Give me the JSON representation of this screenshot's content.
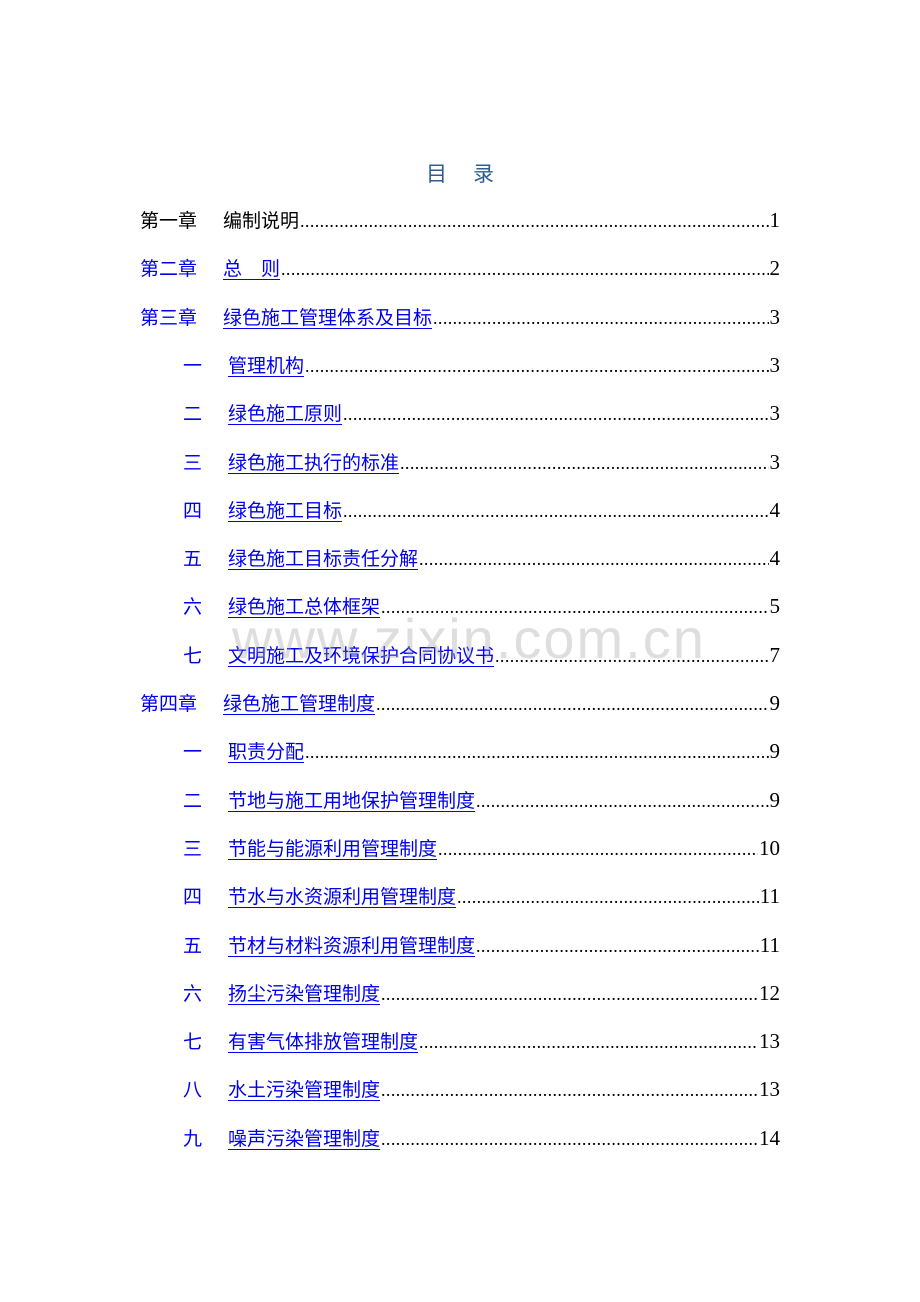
{
  "document": {
    "title_chars": [
      "目",
      "录"
    ],
    "watermark": "www.zixin.com.cn",
    "entries": [
      {
        "level": 1,
        "num": "第一章",
        "title": "编制说明",
        "page": "1",
        "linked": false
      },
      {
        "level": 1,
        "num": "第二章",
        "title": "总　则",
        "page": "2",
        "linked": true
      },
      {
        "level": 1,
        "num": "第三章",
        "title": "绿色施工管理体系及目标",
        "page": "3",
        "linked": true
      },
      {
        "level": 2,
        "num": "一",
        "title": "管理机构",
        "page": "3",
        "linked": true
      },
      {
        "level": 2,
        "num": "二",
        "title": "绿色施工原则",
        "page": "3",
        "linked": true
      },
      {
        "level": 2,
        "num": "三",
        "title": "绿色施工执行的标准",
        "page": "3",
        "linked": true
      },
      {
        "level": 2,
        "num": "四",
        "title": "绿色施工目标",
        "page": "4",
        "linked": true
      },
      {
        "level": 2,
        "num": "五",
        "title": "绿色施工目标责任分解",
        "page": "4",
        "linked": true
      },
      {
        "level": 2,
        "num": "六",
        "title": "绿色施工总体框架",
        "page": "5",
        "linked": true
      },
      {
        "level": 2,
        "num": "七",
        "title": "文明施工及环境保护合同协议书",
        "page": "7",
        "linked": true
      },
      {
        "level": 1,
        "num": "第四章",
        "title": "绿色施工管理制度",
        "page": "9",
        "linked": true
      },
      {
        "level": 2,
        "num": "一",
        "title": "职责分配",
        "page": "9",
        "linked": true
      },
      {
        "level": 2,
        "num": "二",
        "title": "节地与施工用地保护管理制度",
        "page": "9",
        "linked": true
      },
      {
        "level": 2,
        "num": "三",
        "title": "节能与能源利用管理制度",
        "page": "10",
        "linked": true
      },
      {
        "level": 2,
        "num": "四",
        "title": "节水与水资源利用管理制度",
        "page": "11",
        "linked": true
      },
      {
        "level": 2,
        "num": "五",
        "title": "节材与材料资源利用管理制度",
        "page": "11",
        "linked": true
      },
      {
        "level": 2,
        "num": "六",
        "title": "扬尘污染管理制度",
        "page": "12",
        "linked": true
      },
      {
        "level": 2,
        "num": "七",
        "title": "有害气体排放管理制度",
        "page": "13",
        "linked": true
      },
      {
        "level": 2,
        "num": "八",
        "title": "水土污染管理制度",
        "page": "13",
        "linked": true
      },
      {
        "level": 2,
        "num": "九",
        "title": "噪声污染管理制度",
        "page": "14",
        "linked": true
      }
    ]
  },
  "colors": {
    "title": "#2f5d91",
    "link": "#0000ee",
    "text": "#000000"
  }
}
